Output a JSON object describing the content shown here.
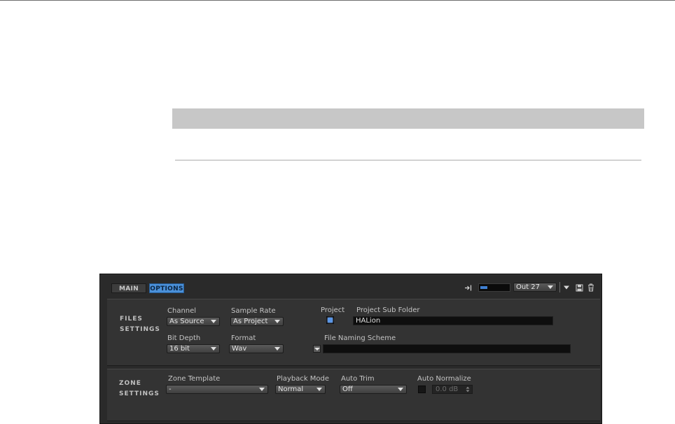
{
  "tabs": {
    "main": "MAIN",
    "options": "OPTIONS"
  },
  "header": {
    "output_label": "Out 27",
    "meter_level": 0.25,
    "icons": [
      "input-arrow-icon",
      "chevron-down-icon",
      "save-icon",
      "trash-icon"
    ]
  },
  "files_settings": {
    "title_line1": "FILES",
    "title_line2": "SETTINGS",
    "channel": {
      "label": "Channel",
      "value": "As Source"
    },
    "sample_rate": {
      "label": "Sample Rate",
      "value": "As Project"
    },
    "project": {
      "label": "Project",
      "checked": true
    },
    "project_sub_folder": {
      "label": "Project Sub Folder",
      "value": "HALion"
    },
    "bit_depth": {
      "label": "Bit Depth",
      "value": "16 bit"
    },
    "format": {
      "label": "Format",
      "value": "Wav"
    },
    "file_naming_scheme": {
      "label": "File Naming Scheme",
      "value": ""
    }
  },
  "zone_settings": {
    "title_line1": "ZONE",
    "title_line2": "SETTINGS",
    "zone_template": {
      "label": "Zone Template",
      "value": "-"
    },
    "playback_mode": {
      "label": "Playback Mode",
      "value": "Normal"
    },
    "auto_trim": {
      "label": "Auto Trim",
      "value": "Off"
    },
    "auto_normalize": {
      "label": "Auto Normalize",
      "checked": false,
      "value": "0.0 dB"
    }
  },
  "colors": {
    "accent": "#4a90d9",
    "panel": "#2d2d2d",
    "section": "#333333"
  }
}
